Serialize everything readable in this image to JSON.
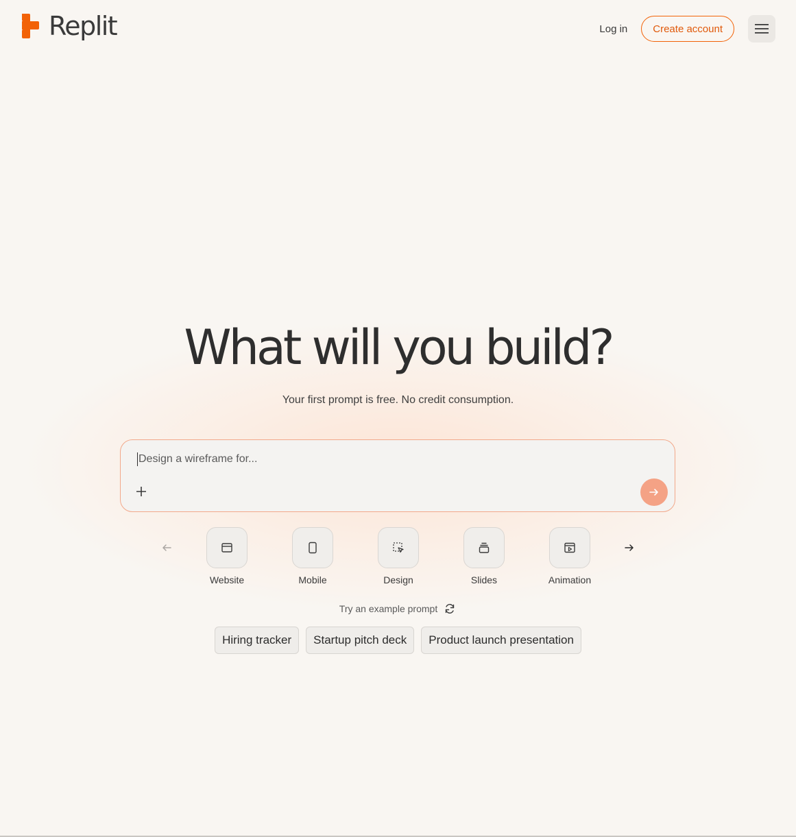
{
  "brand": {
    "name": "Replit",
    "accent_color": "#f26207"
  },
  "nav": {
    "login_label": "Log in",
    "create_account_label": "Create account",
    "menu_icon": "hamburger-menu-icon"
  },
  "hero": {
    "headline": "What will you build?",
    "subtitle": "Your first prompt is free. No credit consumption."
  },
  "prompt": {
    "placeholder": "Design a wireframe for...",
    "value": "",
    "attach_icon": "plus-icon",
    "send_icon": "arrow-right-icon"
  },
  "project_types": [
    {
      "label": "Website",
      "icon": "browser-window-icon"
    },
    {
      "label": "Mobile",
      "icon": "phone-icon"
    },
    {
      "label": "Design",
      "icon": "cursor-select-icon"
    },
    {
      "label": "Slides",
      "icon": "slides-stack-icon"
    },
    {
      "label": "Animation",
      "icon": "play-window-icon"
    }
  ],
  "examples": {
    "label": "Try an example prompt",
    "refresh_icon": "refresh-icon",
    "items": [
      "Hiring tracker",
      "Startup pitch deck",
      "Product launch presentation"
    ]
  }
}
